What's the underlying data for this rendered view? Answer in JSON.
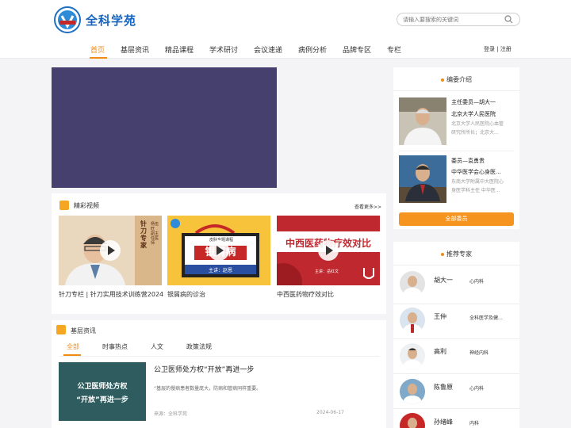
{
  "header": {
    "logo_text": "全科学苑",
    "search_placeholder": "请输入要搜索的关键词",
    "login": "登录 | 注册"
  },
  "nav": [
    "首页",
    "基层资讯",
    "精品课程",
    "学术研讨",
    "会议速递",
    "病例分析",
    "品牌专区",
    "专栏"
  ],
  "videos": {
    "title": "精彩视频",
    "more": "查看更多>>",
    "items": [
      {
        "caption": "针刀专栏 | 针刀实用技术训练营2024",
        "overlay": "针刀专家",
        "overlay_sub": "杨伍旺 副主任医师"
      },
      {
        "caption": "银屑病的诊治",
        "overlay_top": "皮肤专题课程",
        "overlay": "银屑病",
        "overlay_sub": "主讲：赵恩"
      },
      {
        "caption": "中西医药物疗效对比",
        "overlay": "中西医药物疗效对比",
        "overlay_sub": "主讲：岳红文"
      }
    ]
  },
  "news": {
    "title": "基层资讯",
    "tabs": [
      "全部",
      "时事热点",
      "人文",
      "政策法规"
    ],
    "item": {
      "image_line1": "公卫医师处方权",
      "image_line2": "“开放”再进一步",
      "title": "公卫医师处方权“开放”再进一步",
      "desc": "“基层的慢病患者数量庞大，防病和管病同样重要。",
      "source": "来源：全科学苑",
      "date": "2024-06-17"
    }
  },
  "editors": {
    "title": "编委介绍",
    "items": [
      {
        "role": "主任委员—胡大一",
        "org": "北京大学人民医院",
        "desc1": "北京大学人民医院心血管",
        "desc2": "研究所所长；北京大..."
      },
      {
        "role": "委员—袁勇贵",
        "org": "中华医学会心身医...",
        "desc1": "东南大学附属中大医院心",
        "desc2": "身医学科主任 中华医..."
      }
    ],
    "button": "全部委员"
  },
  "experts": {
    "title": "推荐专家",
    "items": [
      {
        "name": "胡大一",
        "dept": "心内科"
      },
      {
        "name": "王仲",
        "dept": "全科医学及健..."
      },
      {
        "name": "高利",
        "dept": "神经内科"
      },
      {
        "name": "陈鲁原",
        "dept": "心内科"
      },
      {
        "name": "孙绪峰",
        "dept": "内科"
      }
    ]
  },
  "colors": {
    "accent": "#f08c16",
    "banner": "#45406d",
    "brand": "#1565c0"
  }
}
